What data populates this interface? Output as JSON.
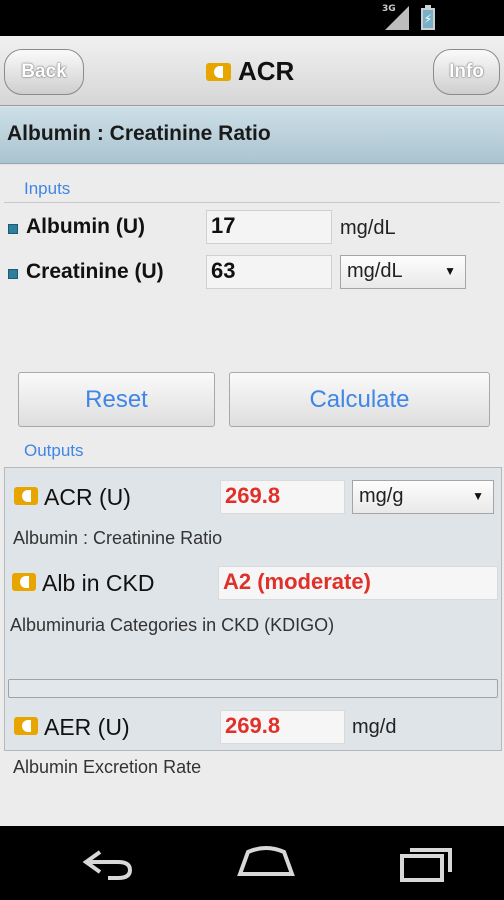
{
  "status_bar": {
    "signal_label": "3G"
  },
  "header": {
    "back_label": "Back",
    "title": "ACR",
    "info_label": "Info",
    "accent_color": "#e8a500"
  },
  "subheader": {
    "title": "Albumin : Creatinine Ratio"
  },
  "inputs": {
    "section_label": "Inputs",
    "rows": [
      {
        "label": "Albumin (U)",
        "value": "17",
        "unit": "mg/dL"
      },
      {
        "label": "Creatinine (U)",
        "value": "63",
        "unit": "mg/dL"
      }
    ]
  },
  "buttons": {
    "reset_label": "Reset",
    "calculate_label": "Calculate"
  },
  "outputs": {
    "section_label": "Outputs",
    "acr": {
      "label": "ACR (U)",
      "value": "269.8",
      "unit": "mg/g",
      "description": "Albumin : Creatinine Ratio"
    },
    "ckd": {
      "label": "Alb in CKD",
      "value": "A2 (moderate)",
      "description": "Albuminuria Categories in CKD (KDIGO)"
    },
    "progress_fraction": 0,
    "aer": {
      "label": "AER (U)",
      "value": "269.8",
      "unit": "mg/d",
      "description": "Albumin Excretion Rate"
    },
    "value_color": "#e0302a"
  },
  "navbar": {
    "icons": [
      "back-icon",
      "home-icon",
      "recents-icon"
    ]
  }
}
